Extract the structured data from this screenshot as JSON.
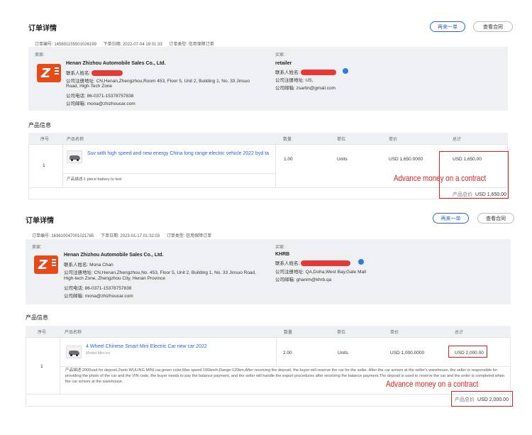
{
  "orders": [
    {
      "title": "订单详情",
      "buttons": {
        "reorder": "再来一单",
        "contract": "查看合同"
      },
      "meta": {
        "order_no": "订单编号: 145691155501026199",
        "order_date": "下单日期: 2022-07-04 19:31:33",
        "order_type": "订单类型: 信用保障订单"
      },
      "seller": {
        "label": "卖家:",
        "company": "Henan Zhizhou Automobile Sales Co., Ltd.",
        "contact": "联系人姓名:",
        "reg_address": "公司注册地址:  CN,Henan,Zhengzhou,Room 453, Floor 5, Unit 2, Building 1, No. 33 Jinsuo",
        "address": "Road, High-Tech Zone",
        "phone": "公司电话: 86-0371-15378757838",
        "email": "公司邮箱: mona@zhizhoucar.com"
      },
      "buyer": {
        "label": "买家:",
        "name": "retailer",
        "contact": "联系人姓名:",
        "reg_address": "公司注册地址: US,",
        "email": "公司邮箱: zsartin@gmail.com"
      },
      "section_title": "产品信息",
      "table_headers": [
        "序号",
        "产品名称",
        "数量",
        "单位",
        "单价",
        "总计"
      ],
      "row": {
        "index": "1",
        "product": "Suv with high speed and new energy China long range electric vehicle 2022 byd ta",
        "quantity": "1.00",
        "unit": "Units",
        "unit_price": "USD 1,650.0000",
        "total": "USD 1,650.00"
      },
      "description": "产品描述:1 piece battery to test",
      "annotation": "Advance money on a contract",
      "grand_total_label": "产品总价",
      "grand_total": "USD 1,650.00"
    },
    {
      "title": "订单详情",
      "buttons": {
        "reorder": "再来一单",
        "contract": "查看合同"
      },
      "meta": {
        "order_no": "订单编号: 163610047001021785",
        "order_date": "下单日期: 2023-01-17 01:32:03",
        "order_type": "订单类型: 信用保障订单"
      },
      "seller": {
        "label": "卖家:",
        "company": "Henan Zhizhou Automobile Sales Co., Ltd.",
        "contact": "联系人姓名:    Mona Chan",
        "reg_address": "公司注册地址:  CN,Henan,Zhengzhou,No. 453, Floor 5, Unit 2, Building 1, No. 33 Jinsuo Road,",
        "address": "High-tech Zone, Zhengzhou City, Henan Province",
        "phone": "公司电话: 86-0371-15378757838",
        "email": "公司邮箱: mona@zhizhoucar.com"
      },
      "buyer": {
        "label": "买家:",
        "name": "KHRB",
        "contact": "联系人姓名:",
        "reg_address": "公司注册地址: QA,Doha,West Bay,Gate Mall",
        "email": "公司邮箱: ghanim@khrb.qa"
      },
      "section_title": "产品信息",
      "table_headers": [
        "序号",
        "产品名称",
        "数量",
        "单位",
        "单价",
        "总计"
      ],
      "row": {
        "index": "1",
        "product": "4 Wheel Chinese Smart Mini Electric Car new car 2022",
        "model": "Model:Mini-ev",
        "quantity": "2.00",
        "unit": "Units",
        "unit_price": "USD 1,000.0000",
        "total": "USD 2,000.00"
      },
      "description": "产品描述:2000usd for deposit,2sets WULING MINI car,green color,Max speed 100km/h,Range:120km,After receiving the deposit, the buyer will reserve the car for the seller. After the car arrives at the seller's warehouse, the seller is responsible for providing the photo of the car and the VIN code, the buyer needs to pay the balance payment, and the seller will handle the export procedures after receiving the balance payment.The deposit is used to reserve the car and the order is completed when the car arrives at the warehouse.",
      "annotation": "Advance money on a contract",
      "grand_total_label": "产品总价",
      "grand_total": "USD 2,000.00"
    }
  ]
}
